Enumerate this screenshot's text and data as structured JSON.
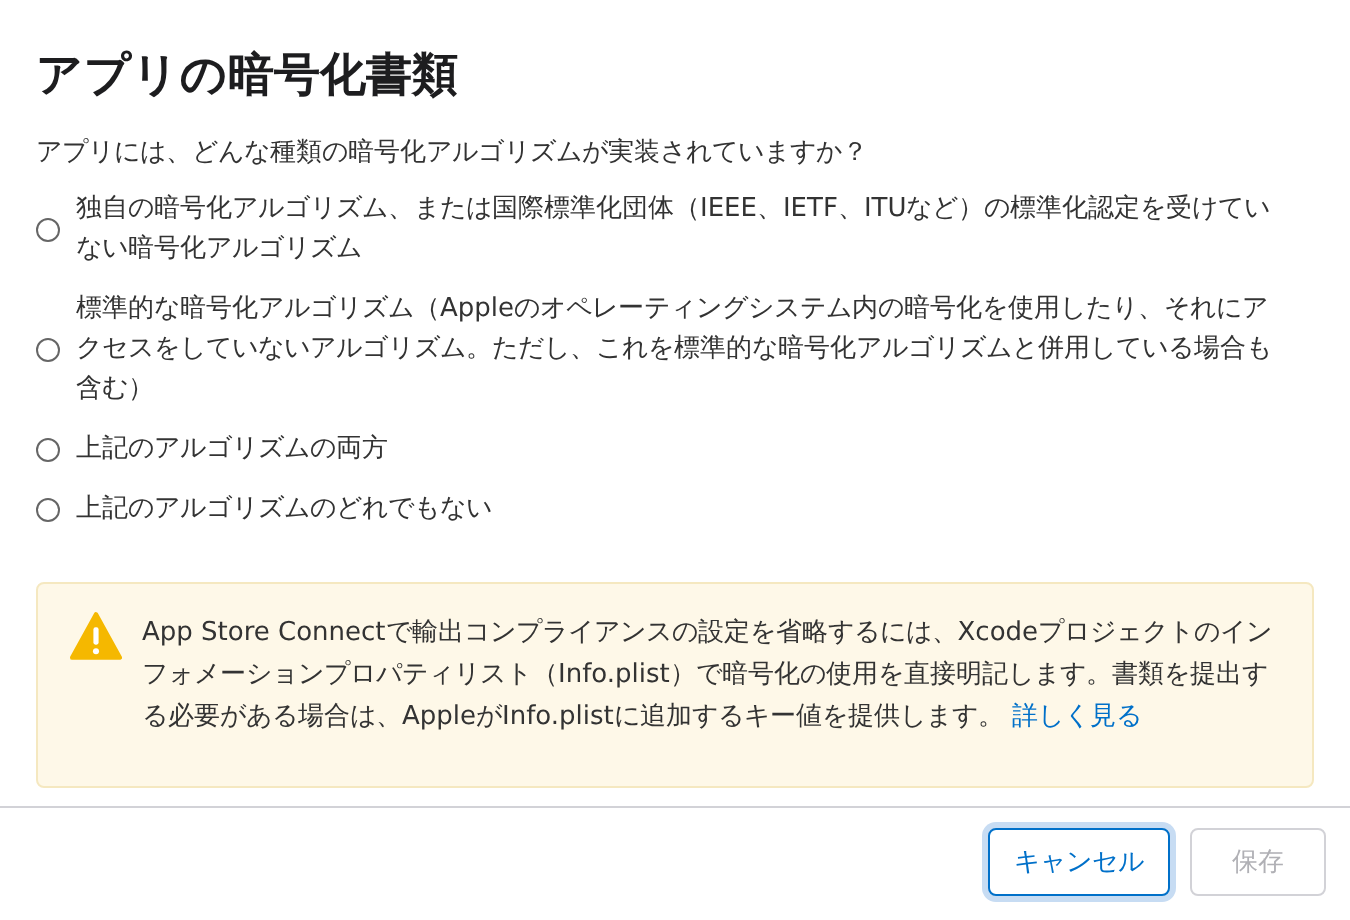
{
  "dialog": {
    "title": "アプリの暗号化書類"
  },
  "question": "アプリには、どんな種類の暗号化アルゴリズムが実装されていますか？",
  "options": [
    {
      "label": "独自の暗号化アルゴリズム、または国際標準化団体（IEEE、IETF、ITUなど）の標準化認定を受けていない暗号化アルゴリズム",
      "selected": false
    },
    {
      "label": "標準的な暗号化アルゴリズム（Appleのオペレーティングシステム内の暗号化を使用したり、それにアクセスをしていないアルゴリズム。ただし、これを標準的な暗号化アルゴリズムと併用している場合も含む）",
      "selected": false
    },
    {
      "label": "上記のアルゴリズムの両方",
      "selected": false
    },
    {
      "label": "上記のアルゴリズムのどれでもない",
      "selected": false
    }
  ],
  "notice": {
    "text": "App Store Connectで輸出コンプライアンスの設定を省略するには、Xcodeプロジェクトのインフォメーションプロパティリスト（Info.plist）で暗号化の使用を直接明記します。書類を提出する必要がある場合は、AppleがInfo.plistに追加するキー値を提供します。",
    "link": "詳しく見る"
  },
  "buttons": [
    {
      "label": "キャンセル",
      "disabled": false
    },
    {
      "label": "保存",
      "disabled": true
    }
  ]
}
